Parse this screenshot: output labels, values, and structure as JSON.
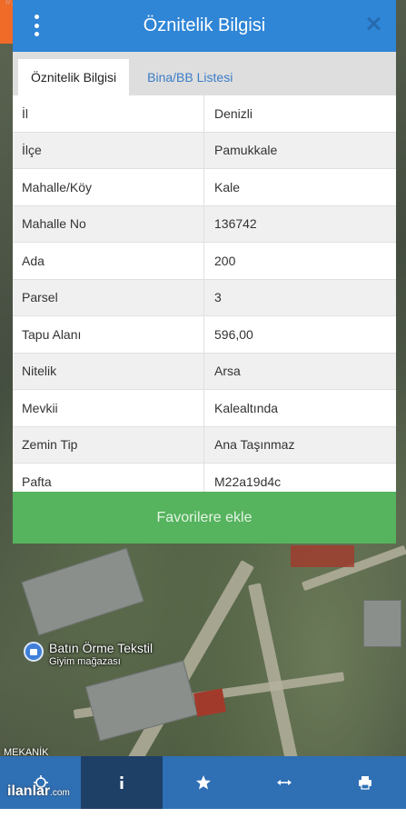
{
  "app": {
    "top_id": "#1316940089",
    "title": "Öznitelik Bilgisi"
  },
  "tabs": [
    {
      "label": "Öznitelik Bilgisi",
      "active": true
    },
    {
      "label": "Bina/BB Listesi",
      "active": false
    }
  ],
  "attributes": [
    {
      "key": "İl",
      "value": "Denizli"
    },
    {
      "key": "İlçe",
      "value": "Pamukkale"
    },
    {
      "key": "Mahalle/Köy",
      "value": "Kale"
    },
    {
      "key": "Mahalle No",
      "value": "136742"
    },
    {
      "key": "Ada",
      "value": "200"
    },
    {
      "key": "Parsel",
      "value": "3"
    },
    {
      "key": "Tapu Alanı",
      "value": "596,00"
    },
    {
      "key": "Nitelik",
      "value": "Arsa"
    },
    {
      "key": "Mevkii",
      "value": "Kalealtında"
    },
    {
      "key": "Zemin Tip",
      "value": "Ana Taşınmaz"
    },
    {
      "key": "Pafta",
      "value": "M22a19d4c"
    }
  ],
  "favorite_button": "Favorilere ekle",
  "map": {
    "place_name": "Batın Örme Tekstil",
    "place_category": "Giyim mağazası",
    "mekanik_label": "MEKANİK"
  },
  "toolbar": [
    {
      "icon": "crosshair-icon",
      "active": false
    },
    {
      "icon": "info-icon",
      "active": true
    },
    {
      "icon": "star-icon",
      "active": false
    },
    {
      "icon": "measure-icon",
      "active": false
    },
    {
      "icon": "print-icon",
      "active": false
    }
  ],
  "watermark": {
    "brand": "ilanlar",
    "domain": ".com"
  },
  "colors": {
    "header": "#2f85d6",
    "favorite": "#56b35e",
    "toolbar": "#2f6fb4",
    "toolbar_active": "#1e3f66"
  }
}
